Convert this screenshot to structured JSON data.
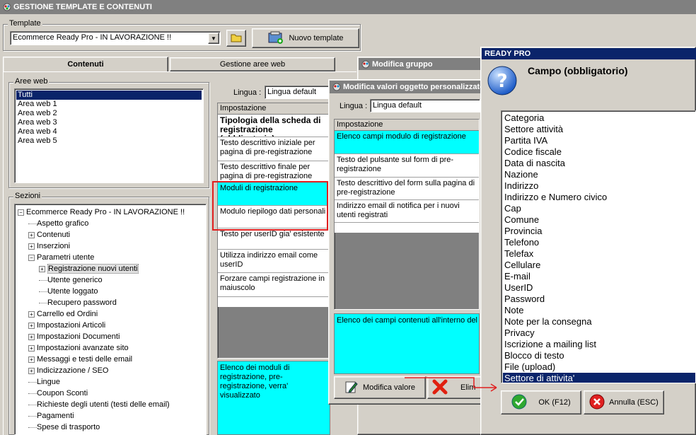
{
  "app": {
    "title": "GESTIONE TEMPLATE E CONTENUTI"
  },
  "template_group": {
    "label": "Template",
    "selected": "Ecommerce Ready Pro - IN LAVORAZIONE !!",
    "new_button": "Nuovo template"
  },
  "tabs": [
    {
      "label": "Contenuti",
      "active": true
    },
    {
      "label": "Gestione aree web",
      "active": false
    }
  ],
  "aree_web": {
    "label": "Aree web",
    "items": [
      "Tutti",
      "Area web 1",
      "Area web 2",
      "Area web 3",
      "Area web 4",
      "Area web 5"
    ],
    "selected_index": 0
  },
  "sezioni": {
    "label": "Sezioni",
    "tree": [
      {
        "label": "Ecommerce Ready Pro - IN LAVORAZIONE !!",
        "expander": "minus"
      },
      {
        "label": "Aspetto grafico",
        "expander": ""
      },
      {
        "label": "Contenuti",
        "expander": "plus"
      },
      {
        "label": "Inserzioni",
        "expander": "plus"
      },
      {
        "label": "Parametri utente",
        "expander": "minus"
      },
      {
        "label": "Registrazione nuovi utenti",
        "expander": "plus"
      },
      {
        "label": "Utente generico",
        "expander": ""
      },
      {
        "label": "Utente loggato",
        "expander": ""
      },
      {
        "label": "Recupero password",
        "expander": ""
      },
      {
        "label": "Carrello ed Ordini",
        "expander": "plus"
      },
      {
        "label": "Impostazioni Articoli",
        "expander": "plus"
      },
      {
        "label": "Impostazioni Documenti",
        "expander": "plus"
      },
      {
        "label": "Impostazioni avanzate sito",
        "expander": "plus"
      },
      {
        "label": "Messaggi e testi delle email",
        "expander": "plus"
      },
      {
        "label": "Indicizzazione / SEO",
        "expander": "plus"
      },
      {
        "label": "Lingue",
        "expander": ""
      },
      {
        "label": "Coupon Sconti",
        "expander": ""
      },
      {
        "label": "Richieste degli utenti (testi delle email)",
        "expander": ""
      },
      {
        "label": "Pagamenti",
        "expander": ""
      },
      {
        "label": "Spese di trasporto",
        "expander": ""
      }
    ]
  },
  "main_panel": {
    "lingua_label": "Lingua :",
    "lingua_value": "Lingua default",
    "grid_header": "Impostazione",
    "rows": [
      "Tipologia della scheda di registrazione (obbligatorio)",
      "Testo descrittivo iniziale per pagina di pre-registrazione",
      "Testo descrittivo finale per pagina di pre-registrazione",
      "Moduli di registrazione",
      "Modulo riepilogo dati personali",
      "Testo per userID gia' esistente",
      "Utilizza indirizzo email come userID",
      "Forzare campi registrazione in maiuscolo"
    ],
    "description": "Elenco dei moduli di registrazione, pre-registrazione, verra' visualizzato"
  },
  "modifica_gruppo": {
    "title": "Modifica gruppo"
  },
  "modifica_valori": {
    "title": "Modifica valori oggetto personalizzato",
    "lingua_label": "Lingua :",
    "lingua_value": "Lingua default",
    "grid_header": "Impostazione",
    "rows": [
      "Elenco campi modulo di registrazione",
      "Testo del pulsante sul form di pre-registrazione",
      "Testo descrittivo del form sulla pagina di pre-registrazione",
      "Indirizzo email di notifica per i nuovi utenti registrati"
    ],
    "description": "Elenco dei campi contenuti all'interno del m",
    "edit_button": "Modifica valore",
    "delete_button": "Elim"
  },
  "ready_pro_dialog": {
    "title": "READY PRO",
    "prompt": "Campo (obbligatorio)",
    "items": [
      "Categoria",
      "Settore attività",
      "Partita IVA",
      "Codice fiscale",
      "Data di nascita",
      "Nazione",
      "Indirizzo",
      "Indirizzo e Numero civico",
      "Cap",
      "Comune",
      "Provincia",
      "Telefono",
      "Telefax",
      "Cellulare",
      "E-mail",
      "UserID",
      "Password",
      "Note",
      "Note per la consegna",
      "Privacy",
      "Iscrizione a mailing list",
      "Blocco di testo",
      "File (upload)",
      "Settore di attivita'"
    ],
    "selected_index": 23,
    "ok_button": "OK (F12)",
    "cancel_button": "Annulla (ESC)"
  },
  "colors": {
    "accent": "#0a246a",
    "highlight": "#00ffff",
    "annotation": "#e02020"
  }
}
